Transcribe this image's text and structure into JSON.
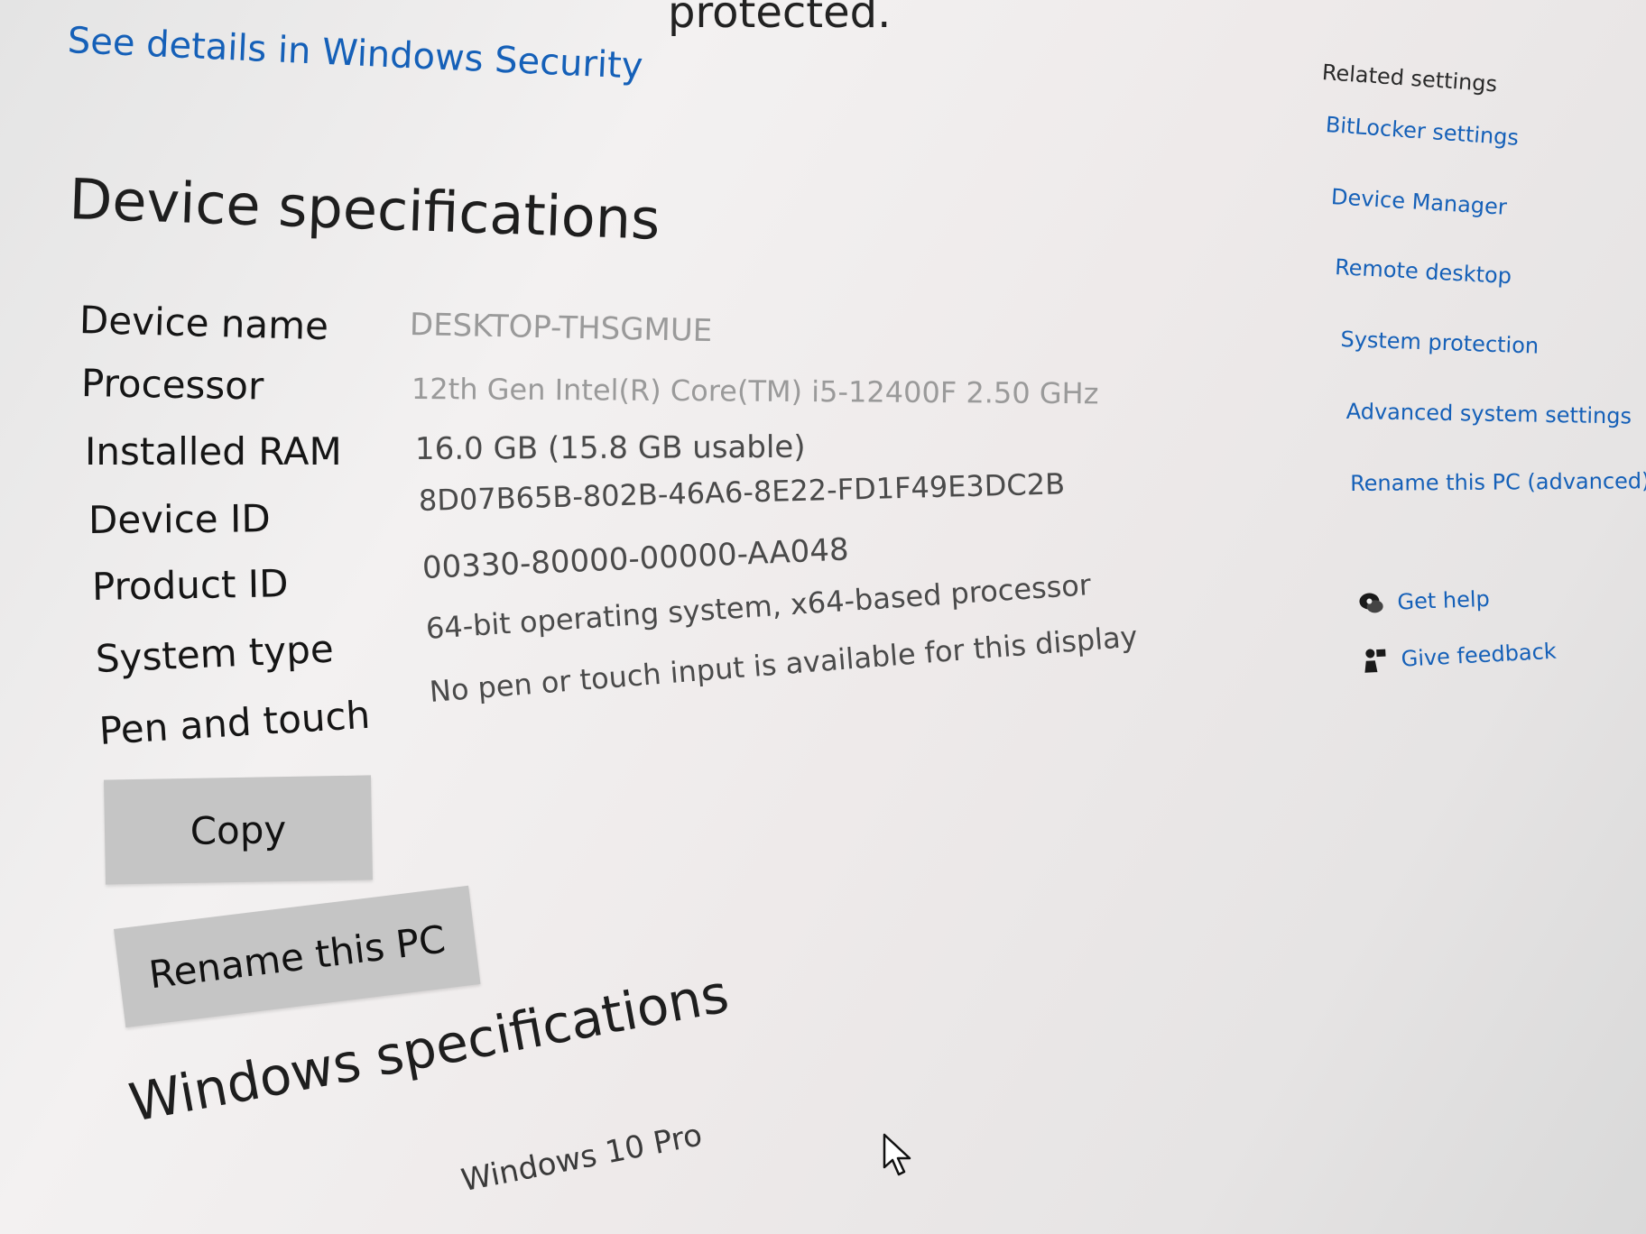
{
  "security": {
    "top_partial_text": "protected.",
    "details_link": "See details in Windows Security"
  },
  "device_specs": {
    "title": "Device specifications",
    "rows": [
      {
        "label": "Device name",
        "value": "DESKTOP-THSGMUE"
      },
      {
        "label": "Processor",
        "value": "12th Gen Intel(R) Core(TM) i5-12400F   2.50 GHz"
      },
      {
        "label": "Installed RAM",
        "value": "16.0 GB (15.8 GB usable)"
      },
      {
        "label": "Device ID",
        "value": "8D07B65B-802B-46A6-8E22-FD1F49E3DC2B"
      },
      {
        "label": "Product ID",
        "value": "00330-80000-00000-AA048"
      },
      {
        "label": "System type",
        "value": "64-bit operating system, x64-based processor"
      },
      {
        "label": "Pen and touch",
        "value": "No pen or touch input is available for this display"
      }
    ],
    "copy_button": "Copy",
    "rename_button": "Rename this PC"
  },
  "windows_specs": {
    "title": "Windows specifications",
    "edition": "Windows 10 Pro"
  },
  "related": {
    "heading": "Related settings",
    "links": [
      "BitLocker settings",
      "Device Manager",
      "Remote desktop",
      "System protection",
      "Advanced system settings",
      "Rename this PC (advanced)"
    ],
    "get_help": "Get help",
    "give_feedback": "Give feedback"
  },
  "colors": {
    "link": "#1560b8",
    "button_bg": "#c5c5c5",
    "page_bg": "#eeeaea"
  },
  "icons": [
    "get-help-icon",
    "give-feedback-icon",
    "mouse-pointer-icon"
  ]
}
